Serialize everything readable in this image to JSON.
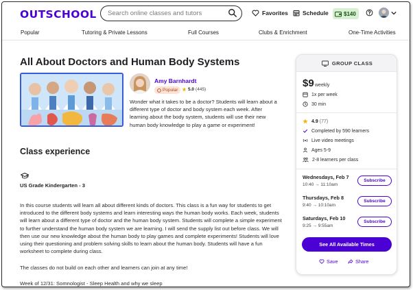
{
  "header": {
    "logo": "OUTSCHOOL",
    "search_placeholder": "Search online classes and tutors",
    "favorites_label": "Favorites",
    "schedule_label": "Schedule",
    "wallet_amount": "$140"
  },
  "nav": {
    "items": [
      "Popular",
      "Tutoring & Private Lessons",
      "Full Courses",
      "Clubs & Enrichment",
      "One-Time Activities"
    ]
  },
  "main": {
    "title": "All About Doctors and Human Body Systems",
    "teacher": {
      "name": "Amy Barnhardt",
      "badge": "Popular",
      "rating": "5.0",
      "reviews": "(445)"
    },
    "summary": "Wonder what it takes to be a doctor? Students will learn about a different type of doctor and body system each week. After learning about the body system, students will use their new human body knowledge to play a game or experiment!",
    "section_title": "Class experience",
    "grade": "US Grade Kindergarten - 3",
    "description": "In this course students will learn all about different kinds of doctors. This class is a fun way for students to get introduced to the different body systems and learn interesting ways the human body works. Each week, students will learn about a different type of doctor and the human body system. Students will complete a simple experiment to further understand the human body system we are learning. I will send the supply list out before class. We will then use our new knowledge about the human body to play games and complete experiments! Students will love using their questioning and problem solving skills to learn about the human body. Students will have a fun worksheet to complete during class.",
    "note": "The classes do not build on each other and learners can join at any time!",
    "week": "Week of 12/31: Somnologist - Sleep Health and why we sleep"
  },
  "card": {
    "header": "GROUP CLASS",
    "price": "$9",
    "price_unit": "weekly",
    "frequency": "1x per week",
    "duration": "30 min",
    "rating": "4.9",
    "rating_count": "(77)",
    "completed": "Completed by 590 learners",
    "live": "Live video meetings",
    "ages": "Ages 5-9",
    "class_size": "2-8 learners per class",
    "slots": [
      {
        "day": "Wednesdays, Feb 7",
        "time": "10:40 → 11:10am"
      },
      {
        "day": "Thursdays, Feb 8",
        "time": "9:40 → 10:10am"
      },
      {
        "day": "Saturdays, Feb 10",
        "time": "9:25 → 9:55am"
      }
    ],
    "subscribe_label": "Subscribe",
    "see_all": "See All Available Times",
    "save": "Save",
    "share": "Share"
  },
  "colors": {
    "brand": "#4b01d4",
    "wallet_bg": "#d7f1d0",
    "popular_bg": "#fde3d6",
    "star": "#f5b50a"
  }
}
